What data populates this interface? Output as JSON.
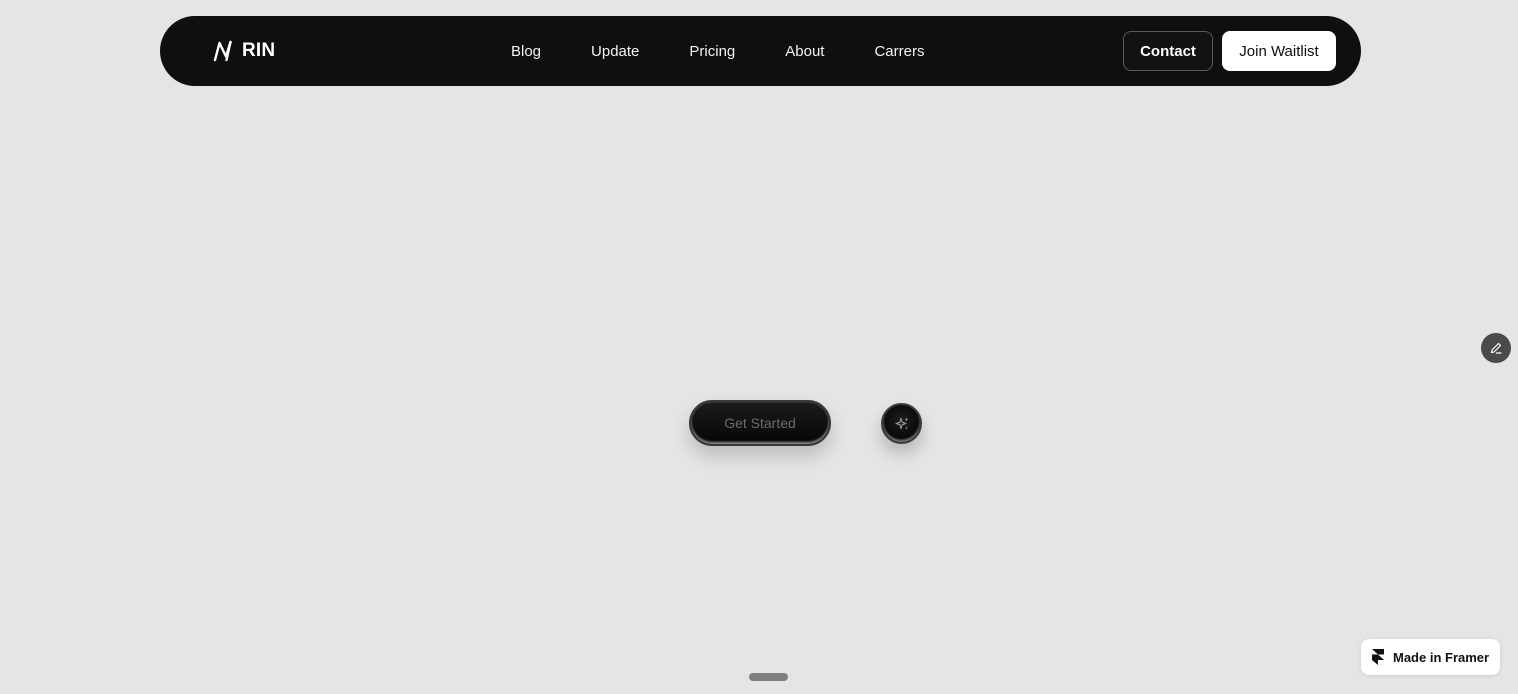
{
  "brand": {
    "name": "RIN",
    "logo_icon": "rin-logo-icon"
  },
  "nav": {
    "links": [
      {
        "label": "Blog"
      },
      {
        "label": "Update"
      },
      {
        "label": "Pricing"
      },
      {
        "label": "About"
      },
      {
        "label": "Carrers"
      }
    ],
    "contact_label": "Contact",
    "waitlist_label": "Join Waitlist"
  },
  "hero": {
    "get_started_label": "Get Started",
    "sparkle_icon": "sparkle-icon"
  },
  "edit_icon": "pencil-icon",
  "badge": {
    "label": "Made in Framer",
    "icon": "framer-logo-icon"
  },
  "colors": {
    "page_background": "#e5e5e5",
    "navbar_background": "#0f0f0f",
    "nav_text": "#f2f2f2",
    "waitlist_background": "#ffffff",
    "get_started_text": "#6c6c6c",
    "edit_fab_background": "#4a4a4a",
    "scroll_handle": "#808080"
  }
}
